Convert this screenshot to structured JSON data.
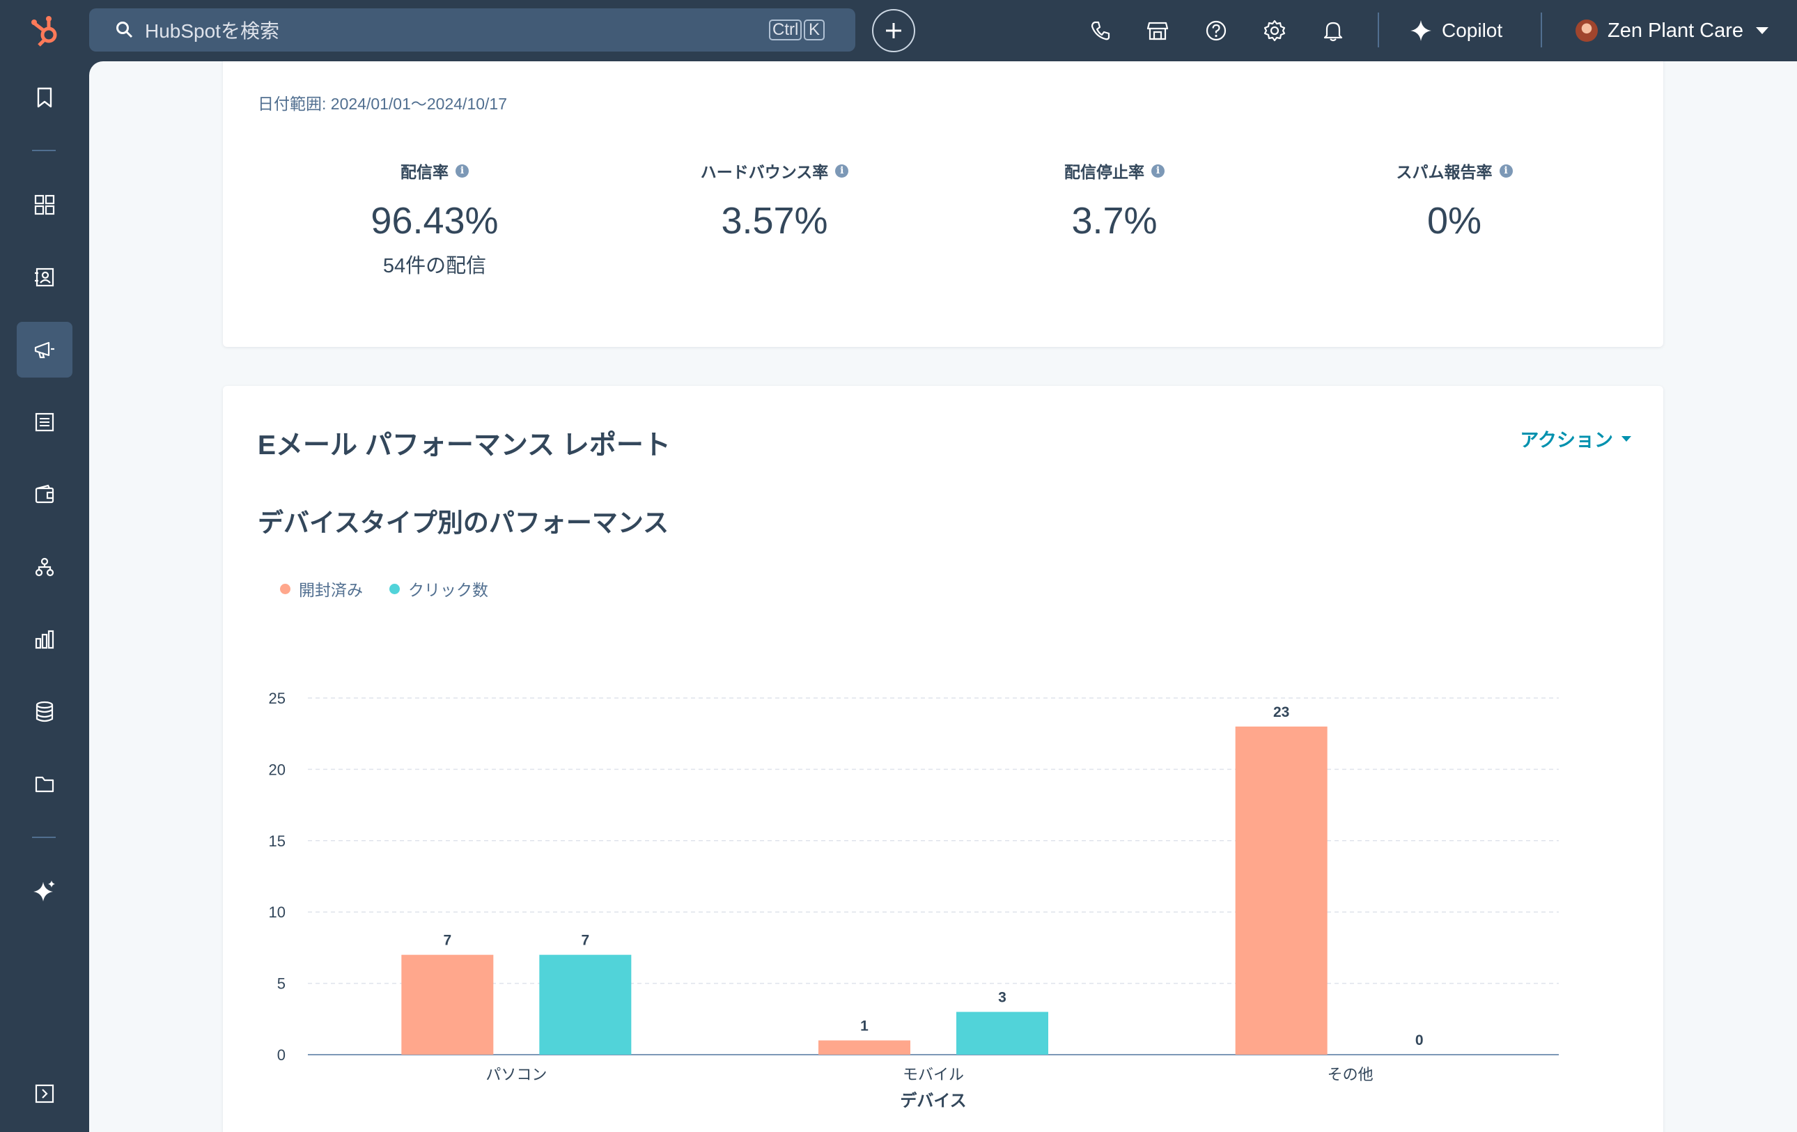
{
  "topbar": {
    "search_placeholder": "HubSpotを検索",
    "shortcut_ctrl": "Ctrl",
    "shortcut_key": "K",
    "copilot_label": "Copilot",
    "account_name": "Zen Plant Care",
    "icons": [
      "phone-icon",
      "marketplace-icon",
      "help-icon",
      "settings-icon",
      "notifications-icon"
    ]
  },
  "sidebar": {
    "items": [
      "bookmark-icon",
      "workspaces-icon",
      "contacts-icon",
      "marketing-icon",
      "content-icon",
      "commerce-icon",
      "automation-icon",
      "reporting-icon",
      "data-management-icon",
      "library-icon",
      "ai-icon"
    ]
  },
  "summary": {
    "date_range": "日付範囲: 2024/01/01〜2024/10/17",
    "metrics": [
      {
        "label": "配信率",
        "value": "96.43%",
        "sub": "54件の配信"
      },
      {
        "label": "ハードバウンス率",
        "value": "3.57%",
        "sub": ""
      },
      {
        "label": "配信停止率",
        "value": "3.7%",
        "sub": ""
      },
      {
        "label": "スパム報告率",
        "value": "0%",
        "sub": ""
      }
    ]
  },
  "report": {
    "title": "Eメール パフォーマンス レポート",
    "action_label": "アクション",
    "chart_title": "デバイスタイプ別のパフォーマンス"
  },
  "colors": {
    "opened": "#ffa78c",
    "clicks": "#51d3d9",
    "accent": "#0091ae",
    "nav_bg": "#2d3e50"
  },
  "chart_data": {
    "type": "bar",
    "categories": [
      "パソコン",
      "モバイル",
      "その他"
    ],
    "series": [
      {
        "name": "開封済み",
        "values": [
          7,
          1,
          23
        ]
      },
      {
        "name": "クリック数",
        "values": [
          7,
          3,
          0
        ]
      }
    ],
    "xlabel": "デバイス",
    "ylabel": "",
    "ylim": [
      0,
      25
    ],
    "yticks": [
      0,
      5,
      10,
      15,
      20,
      25
    ],
    "grid": true,
    "legend_position": "top-left"
  }
}
